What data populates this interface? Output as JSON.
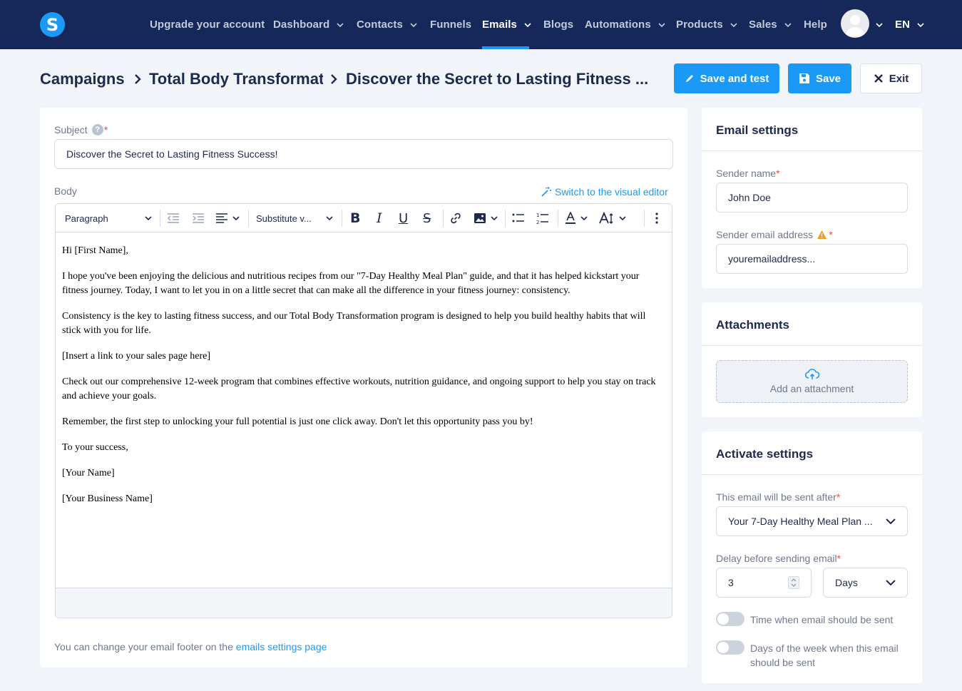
{
  "nav": {
    "logo": "S",
    "items": [
      {
        "label": "Upgrade your account",
        "dropdown": false
      },
      {
        "label": "Dashboard",
        "dropdown": true
      },
      {
        "label": "Contacts",
        "dropdown": true
      },
      {
        "label": "Funnels",
        "dropdown": false
      },
      {
        "label": "Emails",
        "dropdown": true,
        "active": true
      },
      {
        "label": "Blogs",
        "dropdown": false
      },
      {
        "label": "Automations",
        "dropdown": true
      },
      {
        "label": "Products",
        "dropdown": true
      },
      {
        "label": "Sales",
        "dropdown": true
      },
      {
        "label": "Help",
        "dropdown": false
      }
    ],
    "language": "EN"
  },
  "breadcrumb": {
    "items": [
      "Campaigns",
      "Total Body Transformation",
      "Discover the Secret to Lasting Fitness ..."
    ]
  },
  "actions": {
    "save_and_test": "Save and test",
    "save": "Save",
    "exit": "Exit"
  },
  "form": {
    "subject_label": "Subject",
    "subject_help": "?",
    "subject_value": "Discover the Secret to Lasting Fitness Success!",
    "body_label": "Body",
    "switch_editor": "Switch to the visual editor",
    "toolbar": {
      "paragraph": "Paragraph",
      "substitute": "Substitute v..."
    },
    "body_paragraphs": [
      "Hi [First Name],",
      "I hope you've been enjoying the delicious and nutritious recipes from our \"7-Day Healthy Meal Plan\" guide, and that it has helped kickstart your fitness journey. Today, I want to let you in on a little secret that can make all the difference in your fitness journey: consistency.",
      "Consistency is the key to lasting fitness success, and our Total Body Transformation program is designed to help you build healthy habits that will stick with you for life.",
      "[Insert a link to your sales page here]",
      "Check out our comprehensive 12-week program that combines effective workouts, nutrition guidance, and ongoing support to help you stay on track and achieve your goals.",
      "Remember, the first step to unlocking your full potential is just one click away. Don't let this opportunity pass you by!",
      "To your success,",
      "[Your Name]",
      "[Your Business Name]"
    ],
    "footer_note": "You can change your email footer on the",
    "footer_link": "emails settings page"
  },
  "email_settings": {
    "title": "Email settings",
    "sender_name_label": "Sender name",
    "sender_name_value": "John Doe",
    "sender_email_label": "Sender email address",
    "sender_email_value": "youremailaddress..."
  },
  "attachments": {
    "title": "Attachments",
    "add_label": "Add an attachment"
  },
  "activate_settings": {
    "title": "Activate settings",
    "sent_after_label": "This email will be sent after",
    "sent_after_value": "Your 7-Day Healthy Meal Plan ...",
    "delay_label": "Delay before sending email",
    "delay_value": "3",
    "delay_unit": "Days",
    "time_toggle_label": "Time when email should be sent",
    "days_toggle_label": "Days of the week when this email should be sent"
  },
  "colors": {
    "nav_bg": "#16285a",
    "accent": "#1a9af6",
    "warning": "#f39a1e",
    "required": "#e54b4b"
  }
}
